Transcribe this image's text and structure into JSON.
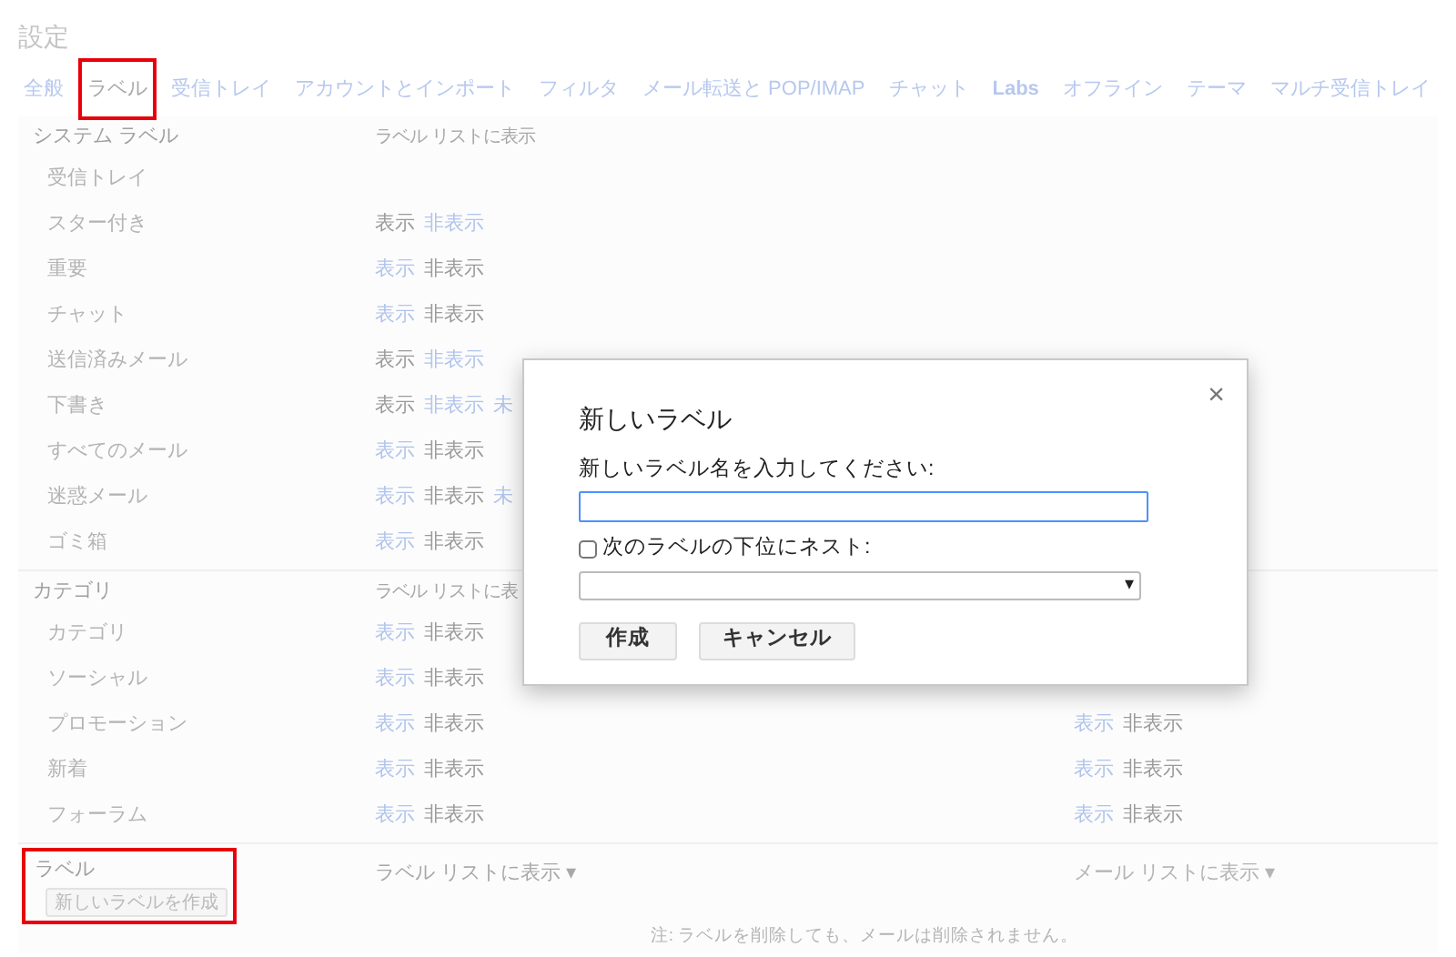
{
  "page_title": "設定",
  "tabs": [
    {
      "label": "全般",
      "selected": false,
      "highlighted": false
    },
    {
      "label": "ラベル",
      "selected": true,
      "highlighted": true
    },
    {
      "label": "受信トレイ",
      "selected": false,
      "highlighted": false
    },
    {
      "label": "アカウントとインポート",
      "selected": false,
      "highlighted": false
    },
    {
      "label": "フィルタ",
      "selected": false,
      "highlighted": false
    },
    {
      "label": "メール転送と POP/IMAP",
      "selected": false,
      "highlighted": false
    },
    {
      "label": "チャット",
      "selected": false,
      "highlighted": false
    },
    {
      "label": "Labs",
      "selected": false,
      "highlighted": false
    },
    {
      "label": "オフライン",
      "selected": false,
      "highlighted": false
    },
    {
      "label": "テーマ",
      "selected": false,
      "highlighted": false
    },
    {
      "label": "マルチ受信トレイ",
      "selected": false,
      "highlighted": false
    }
  ],
  "sections": [
    {
      "title": "システム ラベル",
      "column_header": "ラベル リストに表示",
      "rows": [
        {
          "name": "受信トレイ",
          "options": []
        },
        {
          "name": "スター付き",
          "options": [
            {
              "label": "表示",
              "selected": true
            },
            {
              "label": "非表示",
              "selected": false
            }
          ]
        },
        {
          "name": "重要",
          "options": [
            {
              "label": "表示",
              "selected": false
            },
            {
              "label": "非表示",
              "selected": true
            }
          ]
        },
        {
          "name": "チャット",
          "options": [
            {
              "label": "表示",
              "selected": false
            },
            {
              "label": "非表示",
              "selected": true
            }
          ]
        },
        {
          "name": "送信済みメール",
          "options": [
            {
              "label": "表示",
              "selected": true
            },
            {
              "label": "非表示",
              "selected": false
            }
          ]
        },
        {
          "name": "下書き",
          "options": [
            {
              "label": "表示",
              "selected": true
            },
            {
              "label": "非表示",
              "selected": false
            },
            {
              "label": "未",
              "selected": false
            }
          ]
        },
        {
          "name": "すべてのメール",
          "options": [
            {
              "label": "表示",
              "selected": false
            },
            {
              "label": "非表示",
              "selected": true
            }
          ]
        },
        {
          "name": "迷惑メール",
          "options": [
            {
              "label": "表示",
              "selected": false
            },
            {
              "label": "非表示",
              "selected": true
            },
            {
              "label": "未",
              "selected": false
            }
          ]
        },
        {
          "name": "ゴミ箱",
          "options": [
            {
              "label": "表示",
              "selected": false
            },
            {
              "label": "非表示",
              "selected": true
            }
          ]
        }
      ]
    },
    {
      "title": "カテゴリ",
      "column_header": "ラベル リストに表",
      "rows": [
        {
          "name": "カテゴリ",
          "options": [
            {
              "label": "表示",
              "selected": false
            },
            {
              "label": "非表示",
              "selected": true
            }
          ]
        },
        {
          "name": "ソーシャル",
          "options": [
            {
              "label": "表示",
              "selected": false
            },
            {
              "label": "非表示",
              "selected": true
            }
          ]
        },
        {
          "name": "プロモーション",
          "options": [
            {
              "label": "表示",
              "selected": false
            },
            {
              "label": "非表示",
              "selected": true
            }
          ],
          "mail_options": [
            {
              "label": "表示",
              "selected": false
            },
            {
              "label": "非表示",
              "selected": true
            }
          ]
        },
        {
          "name": "新着",
          "options": [
            {
              "label": "表示",
              "selected": false
            },
            {
              "label": "非表示",
              "selected": true
            }
          ],
          "mail_options": [
            {
              "label": "表示",
              "selected": false
            },
            {
              "label": "非表示",
              "selected": true
            }
          ]
        },
        {
          "name": "フォーラム",
          "options": [
            {
              "label": "表示",
              "selected": false
            },
            {
              "label": "非表示",
              "selected": true
            }
          ],
          "mail_options": [
            {
              "label": "表示",
              "selected": false
            },
            {
              "label": "非表示",
              "selected": true
            }
          ]
        }
      ]
    }
  ],
  "labels_section": {
    "title": "ラベル",
    "create_button": "新しいラベルを作成",
    "highlighted": true,
    "column_header": "ラベル リストに表示 ▾",
    "mail_column_header": "メール リストに表示 ▾",
    "note": "注: ラベルを削除しても、メールは削除されません。"
  },
  "dialog": {
    "title": "新しいラベル",
    "close": "×",
    "name_label": "新しいラベル名を入力してください:",
    "nest_checkbox": {
      "label": "次のラベルの下位にネスト:",
      "checked": false
    },
    "dropdown_arrow": "▾",
    "buttons": [
      "作成",
      "キャンセル"
    ]
  }
}
